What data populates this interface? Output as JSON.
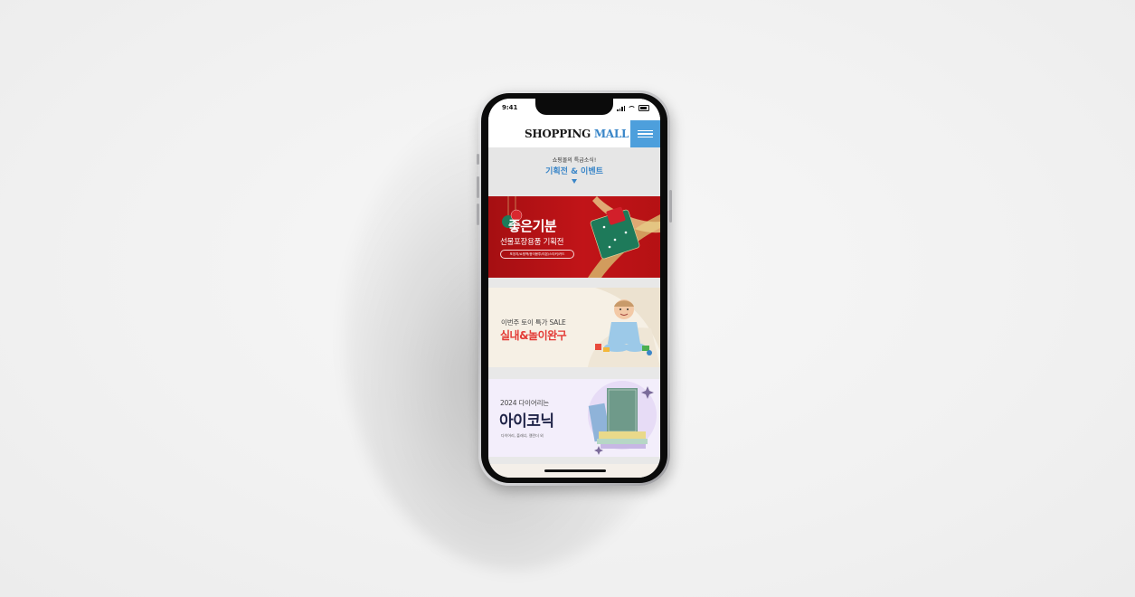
{
  "status_bar": {
    "time": "9:41"
  },
  "header": {
    "logo_main": "SHOPPING",
    "logo_accent": "MALL"
  },
  "section": {
    "subtitle": "쇼핑몰의 특급소식!",
    "title": "기획전 & 이벤트"
  },
  "banners": [
    {
      "title": "좋은기분",
      "subtitle": "선물포장용품 기획전",
      "pill": "포장지/쇼핑백/종이봉투/리본/스티커/카드"
    },
    {
      "subtitle": "이번주 토이 특가 SALE",
      "title": "실내&놀이완구"
    },
    {
      "subtitle": "2024 다이어리는",
      "title": "아이코닉",
      "note": "다이어리, 플래너, 캘린더 외"
    }
  ],
  "colors": {
    "accent": "#3a86c8",
    "menu": "#4d9fdc",
    "banner1_bg": "#b51114",
    "banner2_title": "#e33a35",
    "banner3_title": "#1f2347"
  }
}
